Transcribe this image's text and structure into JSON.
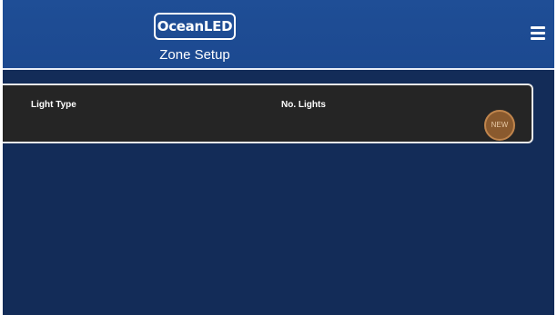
{
  "header": {
    "logo_text": "OceanLED",
    "title": "Zone Setup",
    "menu_icon": "hamburger-menu-icon"
  },
  "panel": {
    "columns": [
      "Light Type",
      "No. Lights"
    ],
    "new_button_label": "NEW"
  },
  "colors": {
    "background": "#132c58",
    "header": "#1f4e96",
    "panel": "#252525",
    "new_button": "#8a5a2e"
  }
}
